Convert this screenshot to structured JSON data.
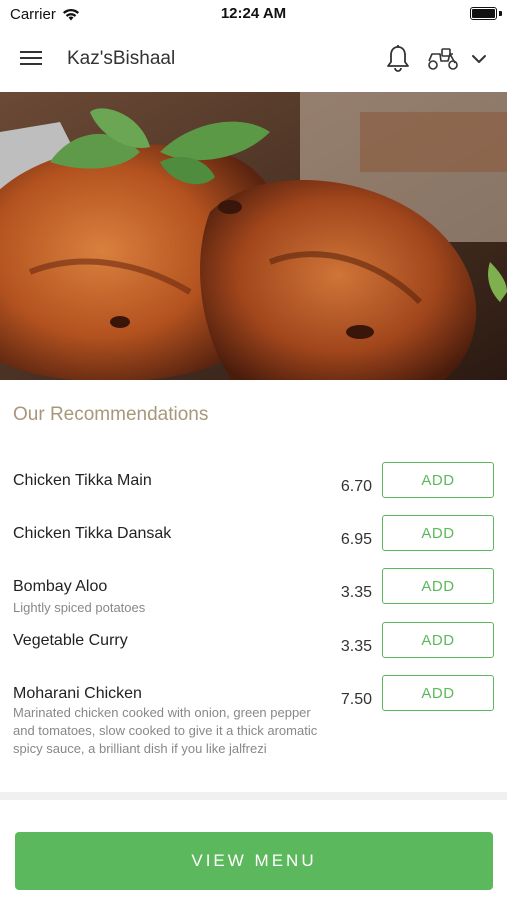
{
  "status_bar": {
    "carrier": "Carrier",
    "time": "12:24 AM"
  },
  "header": {
    "title": "Kaz'sBishaal",
    "icons": [
      "menu-icon",
      "bell-icon",
      "scooter-icon",
      "chevron-down-icon"
    ]
  },
  "recommendations": {
    "title": "Our Recommendations",
    "items": [
      {
        "name": "Chicken Tikka Main",
        "description": "",
        "price": "6.70",
        "add_label": "ADD"
      },
      {
        "name": "Chicken Tikka Dansak",
        "description": "",
        "price": "6.95",
        "add_label": "ADD"
      },
      {
        "name": "Bombay Aloo",
        "description": "Lightly spiced potatoes",
        "price": "3.35",
        "add_label": "ADD"
      },
      {
        "name": "Vegetable Curry",
        "description": "",
        "price": "3.35",
        "add_label": "ADD"
      },
      {
        "name": "Moharani Chicken",
        "description": "Marinated chicken cooked with onion, green pepper and tomatoes, slow cooked to give it a thick aromatic spicy sauce, a brilliant dish if you like jalfrezi",
        "price": "7.50",
        "add_label": "ADD"
      }
    ]
  },
  "footer": {
    "view_menu_label": "VIEW MENU"
  },
  "colors": {
    "accent": "#5cb85c",
    "section_title": "#a8987a"
  }
}
